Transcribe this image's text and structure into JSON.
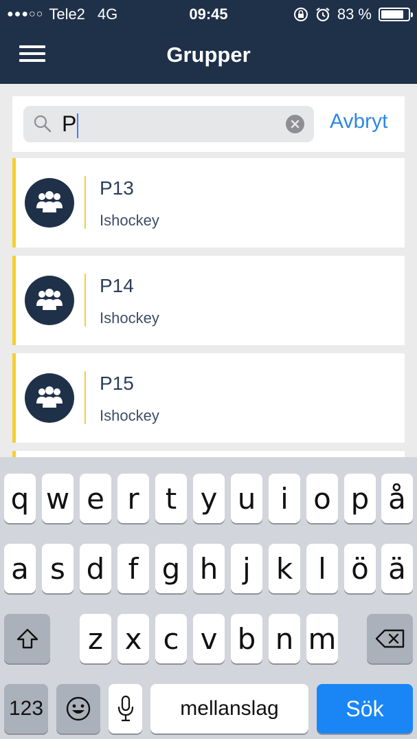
{
  "status_bar": {
    "carrier": "Tele2",
    "network": "4G",
    "time": "09:45",
    "battery": "83 %",
    "battery_level": 0.83
  },
  "header": {
    "title": "Grupper"
  },
  "search": {
    "query": "P",
    "cancel_label": "Avbryt"
  },
  "groups": [
    {
      "name": "P13",
      "sport": "Ishockey"
    },
    {
      "name": "P14",
      "sport": "Ishockey"
    },
    {
      "name": "P15",
      "sport": "Ishockey"
    }
  ],
  "keyboard": {
    "row1": [
      "q",
      "w",
      "e",
      "r",
      "t",
      "y",
      "u",
      "i",
      "o",
      "p",
      "å"
    ],
    "row2": [
      "a",
      "s",
      "d",
      "f",
      "g",
      "h",
      "j",
      "k",
      "l",
      "ö",
      "ä"
    ],
    "row3": [
      "z",
      "x",
      "c",
      "v",
      "b",
      "n",
      "m"
    ],
    "numbers_label": "123",
    "space_label": "mellanslag",
    "search_label": "Sök"
  },
  "colors": {
    "header_bg": "#1f3049",
    "accent_yellow": "#f5cf2e",
    "link_blue": "#2d87e6",
    "search_key_blue": "#1a86f5"
  }
}
